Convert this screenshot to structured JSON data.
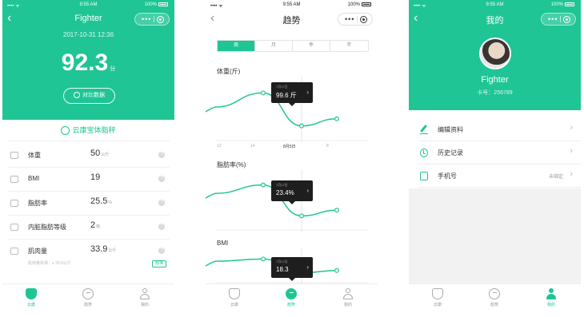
{
  "status": {
    "carrier": "•••• ᯤ",
    "time": "9:55 AM",
    "battery": "100%"
  },
  "screens": {
    "report": {
      "title": "Fighter",
      "date": "2017-10-31 12:36",
      "score": {
        "value": "92.3",
        "unit": "分"
      },
      "compare_button": "对比数据",
      "brand": "云康宝体脂秤",
      "metrics": [
        {
          "name": "体重",
          "value": "50",
          "unit": "公斤"
        },
        {
          "name": "BMI",
          "value": "19",
          "unit": ""
        },
        {
          "name": "脂肪率",
          "value": "25.5",
          "unit": "%"
        },
        {
          "name": "内脏脂肪等级",
          "value": "2",
          "unit": "级"
        },
        {
          "name": "肌肉量",
          "value": "33.9",
          "unit": "公斤",
          "sub": "肌肉量标准：≥ 33.6公斤",
          "tag": "标准"
        }
      ]
    },
    "trend": {
      "title": "趋势",
      "segments": [
        "周",
        "月",
        "季",
        "年"
      ],
      "active_segment": 0,
      "charts": [
        {
          "title": "体重(斤)",
          "tip_date": "7月17日",
          "tip_value": "99.6 斤"
        },
        {
          "title": "脂肪率(%)",
          "tip_date": "7月17日",
          "tip_value": "23.4%"
        },
        {
          "title": "BMI",
          "tip_date": "7月17日",
          "tip_value": "18.3"
        }
      ],
      "x_ticks": [
        "12",
        "14",
        "8月5日",
        "8"
      ]
    },
    "profile": {
      "title": "我的",
      "name": "Fighter",
      "user_id": "卡号：256789",
      "menu": [
        {
          "label": "编辑资料",
          "value": ""
        },
        {
          "label": "历史记录",
          "value": ""
        },
        {
          "label": "手机号",
          "value": "未绑定"
        }
      ]
    }
  },
  "tabbar": [
    "云康",
    "趋势",
    "我的"
  ],
  "chart_data": [
    {
      "type": "line",
      "title": "体重(斤)",
      "x": [
        "12",
        "14",
        "8月5日",
        "8"
      ],
      "series": [
        {
          "values": [
            100.4,
            101.0,
            99.6,
            99.9
          ]
        }
      ]
    },
    {
      "type": "line",
      "title": "脂肪率(%)",
      "x": [
        "12",
        "14",
        "8月5日",
        "8"
      ],
      "series": [
        {
          "values": [
            24.2,
            24.5,
            23.4,
            23.6
          ]
        }
      ]
    },
    {
      "type": "line",
      "title": "BMI",
      "x": [
        "12",
        "14",
        "8月5日",
        "8"
      ],
      "series": [
        {
          "values": [
            18.8,
            18.9,
            18.3,
            18.4
          ]
        }
      ]
    }
  ],
  "colors": {
    "accent": "#1fc594",
    "tooltip": "#1e1e1e"
  }
}
